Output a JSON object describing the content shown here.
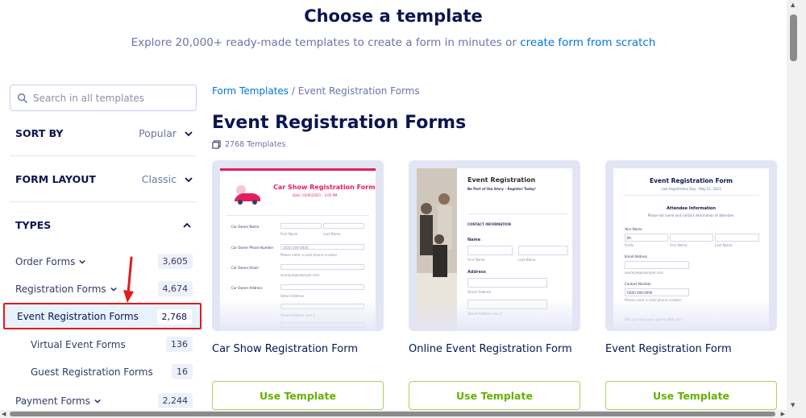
{
  "header": {
    "title": "Choose a template",
    "subtitle_prefix": "Explore 20,000+ ready-made templates to create a form in minutes or",
    "subtitle_link": "create form from scratch"
  },
  "sidebar": {
    "search_placeholder": "Search in all templates",
    "sort_by": {
      "label": "SORT BY",
      "value": "Popular"
    },
    "form_layout": {
      "label": "FORM LAYOUT",
      "value": "Classic"
    },
    "types_label": "TYPES",
    "types": [
      {
        "label": "Order Forms",
        "count": "3,605"
      },
      {
        "label": "Registration Forms",
        "count": "4,674"
      },
      {
        "label": "Event Registration Forms",
        "count": "2,768"
      },
      {
        "label": "Virtual Event Forms",
        "count": "136"
      },
      {
        "label": "Guest Registration Forms",
        "count": "16"
      },
      {
        "label": "Payment Forms",
        "count": "2,244"
      }
    ]
  },
  "main": {
    "breadcrumb": {
      "root": "Form Templates",
      "separator": "/",
      "current": "Event Registration Forms"
    },
    "title": "Event Registration Forms",
    "template_count": "2768 Templates",
    "cards": [
      {
        "name": "Car Show Registration Form",
        "button": "Use Template",
        "preview": {
          "title": "Car Show Registration Form",
          "date": "Date: 03/05/2021 - 3:00 PM",
          "fields": [
            "Car Owner Name",
            "Car Owner Phone Number",
            "Car Owner Email",
            "Car Owner Address"
          ],
          "sub": [
            "First Name",
            "Last Name",
            "(000) 000-0000",
            "Please enter a valid phone number.",
            "example@example.com",
            "Street Address",
            "Street Address Line 2"
          ]
        }
      },
      {
        "name": "Online Event Registration Form",
        "button": "Use Template",
        "preview": {
          "title": "Event Registration",
          "tagline": "Be Part of the Story – Register Today!",
          "section": "CONTACT INFORMATION",
          "fields": [
            "Name",
            "Address"
          ],
          "sub": [
            "First Name",
            "Last Name",
            "Street Address",
            "Street Address Line 2"
          ]
        }
      },
      {
        "name": "Event Registration Form",
        "button": "Use Template",
        "preview": {
          "title": "Event Registration Form",
          "date": "Last Registration Day - May 21, 2023",
          "section": "Attendee Information",
          "section_note": "Please list name and contact information of attendee.",
          "fields": [
            "Your Name",
            "Email Address",
            "Contact Number"
          ],
          "sub": [
            "Mr.",
            "Prefix",
            "First Name",
            "Last Name",
            "example@example.com",
            "(000) 000-0000",
            "Please enter a valid phone number.",
            "Will you have your guests with you?"
          ]
        }
      }
    ]
  },
  "colors": {
    "brand_blue": "#0075e3",
    "navy": "#0a1551",
    "green": "#64b200",
    "highlight_red": "#e31b1b",
    "car_pink": "#e21f5d"
  },
  "icons": [
    "search-icon",
    "chevron-down-icon",
    "chevron-up-icon",
    "template-count-icon",
    "red-arrow-icon"
  ]
}
